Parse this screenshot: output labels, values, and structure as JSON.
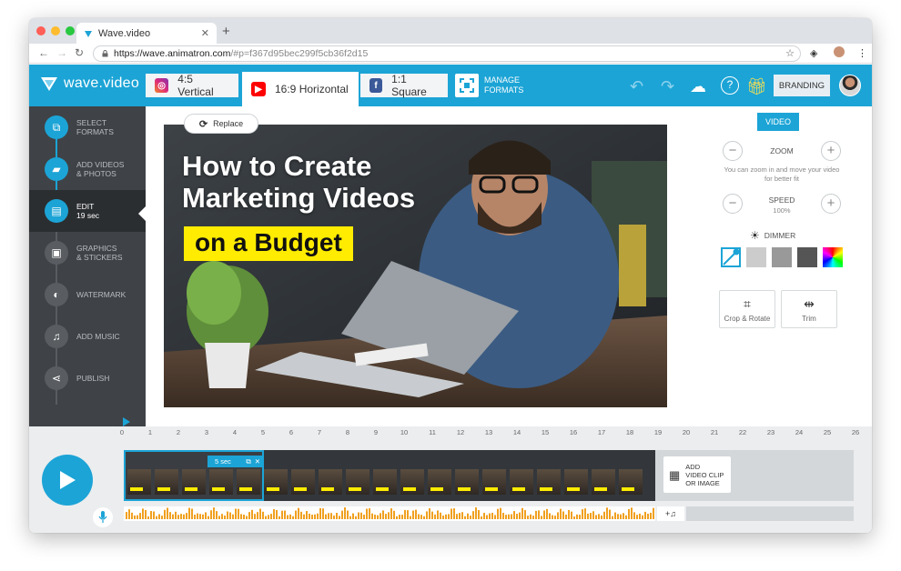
{
  "browser": {
    "tab_title": "Wave.video",
    "url_host": "https://wave.animatron.com",
    "url_rest": "/#p=f367d95bec299f5cb36f2d15"
  },
  "app": {
    "logo_text": "wave.video",
    "formats": [
      {
        "label": "4:5 Vertical",
        "icon": "instagram-icon",
        "color": "#c13584"
      },
      {
        "label": "16:9 Horizontal",
        "icon": "youtube-icon",
        "color": "#ff0000"
      },
      {
        "label": "1:1 Square",
        "icon": "facebook-icon",
        "color": "#3b5998"
      }
    ],
    "manage_formats": [
      "MANAGE",
      "FORMATS"
    ],
    "branding": "BRANDING",
    "accent": "#1ca4d6"
  },
  "steps": [
    {
      "title": "SELECT",
      "title2": "FORMATS"
    },
    {
      "title": "ADD VIDEOS",
      "title2": "& PHOTOS"
    },
    {
      "title": "EDIT",
      "sub": "19 sec"
    },
    {
      "title": "GRAPHICS",
      "title2": "& STICKERS"
    },
    {
      "title": "WATERMARK"
    },
    {
      "title": "ADD MUSIC"
    },
    {
      "title": "PUBLISH"
    }
  ],
  "canvas": {
    "replace_label": "Replace",
    "headline_line1": "How to Create",
    "headline_line2": "Marketing Videos",
    "highlight": "on a Budget",
    "highlight_color": "#ffec00"
  },
  "panel": {
    "video_label": "VIDEO",
    "zoom_label": "ZOOM",
    "zoom_hint_1": "You can zoom in and move your video",
    "zoom_hint_2": "for better fit",
    "speed_label": "SPEED",
    "speed_value": "100%",
    "dimmer_label": "DIMMER",
    "swatches": [
      "#cccccc",
      "#999999",
      "#555555"
    ],
    "crop_label": "Crop & Rotate",
    "trim_label": "Trim"
  },
  "timeline": {
    "ticks": [
      "0",
      "1",
      "2",
      "3",
      "4",
      "5",
      "6",
      "7",
      "8",
      "9",
      "10",
      "11",
      "12",
      "13",
      "14",
      "15",
      "16",
      "17",
      "18",
      "19",
      "20",
      "21",
      "22",
      "23",
      "24",
      "25",
      "26"
    ],
    "clip_duration": "5 sec",
    "add_clip_lines": [
      "ADD",
      "VIDEO CLIP",
      "OR IMAGE"
    ]
  }
}
